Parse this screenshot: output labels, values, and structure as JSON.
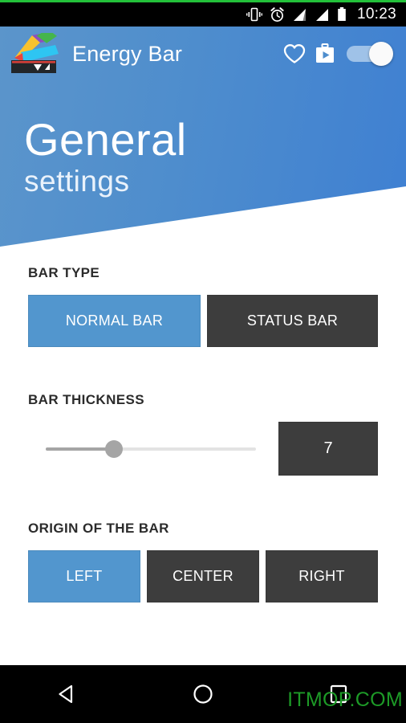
{
  "status_bar": {
    "time": "10:23",
    "icons": [
      "vibrate-icon",
      "alarm-icon",
      "signal-icon",
      "signal-icon",
      "battery-icon"
    ]
  },
  "app_bar": {
    "title": "Energy Bar",
    "icon": "energy-bar-app-icon",
    "actions": [
      {
        "name": "favorite-heart-icon"
      },
      {
        "name": "play-store-icon"
      }
    ],
    "toggle": {
      "name": "master-enable-toggle",
      "state": "on"
    }
  },
  "page_header": {
    "title": "General",
    "subtitle": "settings"
  },
  "sections": {
    "bar_type": {
      "label": "BAR TYPE",
      "options": [
        {
          "label": "NORMAL BAR",
          "selected": true
        },
        {
          "label": "STATUS BAR",
          "selected": false
        }
      ]
    },
    "bar_thickness": {
      "label": "BAR THICKNESS",
      "value": "7",
      "slider_percent": 28
    },
    "origin": {
      "label": "ORIGIN OF THE BAR",
      "options": [
        {
          "label": "LEFT",
          "selected": true
        },
        {
          "label": "CENTER",
          "selected": false
        },
        {
          "label": "RIGHT",
          "selected": false
        }
      ]
    }
  },
  "nav_bar": {
    "back": "back-icon",
    "home": "home-icon",
    "recents": "recents-icon"
  },
  "watermark": "ITMOP.COM",
  "colors": {
    "accent_blue": "#5296ce",
    "header_blue_left": "#5b95cb",
    "header_blue_right": "#3f80d2",
    "dark_button": "#3d3d3d",
    "watermark_green": "#1d9a27",
    "status_green": "#23c13a"
  }
}
